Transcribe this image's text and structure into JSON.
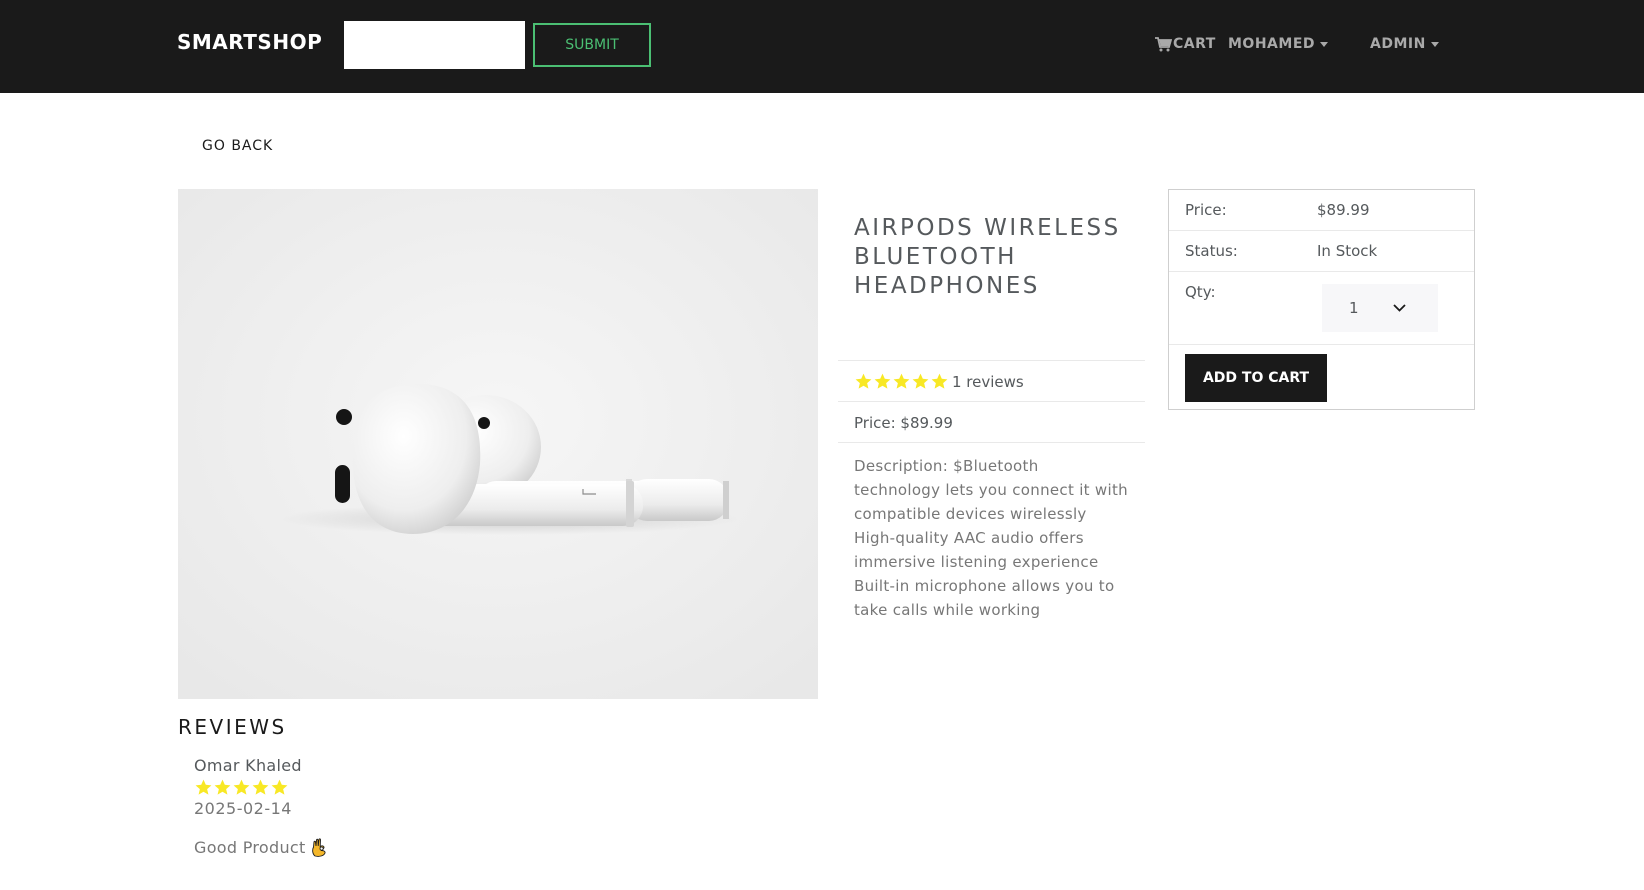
{
  "navbar": {
    "brand": "SMARTSHOP",
    "search": {
      "value": "",
      "placeholder": ""
    },
    "submit_label": "SUBMIT",
    "cart_label": "CART",
    "user_label": "MOHAMED",
    "admin_label": "ADMIN",
    "cart_icon": "shopping-cart-icon"
  },
  "go_back_label": "GO BACK",
  "product": {
    "image_icon": "airpods-product-photo",
    "name": "AIRPODS WIRELESS BLUETOOTH HEADPHONES",
    "rating": 5,
    "reviews_text": "1 reviews",
    "price_text": "Price: $89.99",
    "description": "Description: $Bluetooth technology lets you connect it with compatible devices wirelessly High-quality AAC audio offers immersive listening experience Built-in microphone allows you to take calls while working"
  },
  "purchase": {
    "price_label": "Price:",
    "price_value": "$89.99",
    "status_label": "Status:",
    "status_value": "In Stock",
    "qty_label": "Qty:",
    "qty_value": "1",
    "add_to_cart_label": "ADD TO CART"
  },
  "reviews": {
    "heading": "REVIEWS",
    "items": [
      {
        "name": "Omar Khaled",
        "rating": 5,
        "date": "2025-02-14",
        "comment": "Good Product",
        "emoji_icon": "ok-hand-icon"
      }
    ]
  },
  "colors": {
    "navbar_bg": "#1a1a1a",
    "accent_green": "#4bbf73",
    "star_yellow": "#f8e825",
    "button_dark": "#1a1a1a"
  }
}
